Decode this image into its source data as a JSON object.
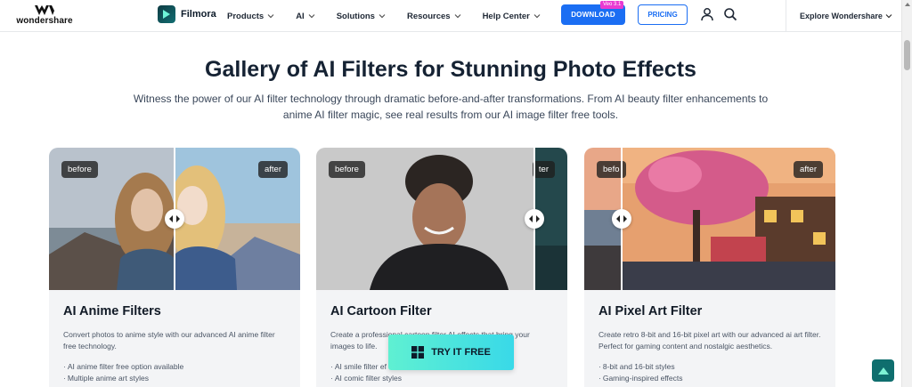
{
  "header": {
    "brand": "wondershare",
    "product": "Filmora",
    "nav": [
      "Products",
      "AI",
      "Solutions",
      "Resources",
      "Help Center"
    ],
    "download_label": "DOWNLOAD",
    "download_badge": "Veo 3.1",
    "pricing_label": "PRICING",
    "explore_label": "Explore Wondershare"
  },
  "hero": {
    "title": "Gallery of AI Filters for Stunning Photo Effects",
    "subtitle": "Witness the power of our AI filter technology through dramatic before-and-after transformations. From AI beauty filter enhancements to anime AI filter magic, see real results from our AI image filter free tools."
  },
  "cards": [
    {
      "before": "before",
      "after": "after",
      "title": "AI Anime Filters",
      "desc": "Convert photos to anime style with our advanced AI anime filter free technology.",
      "features": [
        "AI anime filter free option available",
        "Multiple anime art styles"
      ]
    },
    {
      "before": "before",
      "after": "ter",
      "title": "AI Cartoon Filter",
      "desc": "Create a professional cartoon filter AI effects that bring your images to life.",
      "features": [
        "AI smile filter ef",
        "AI comic filter styles"
      ]
    },
    {
      "before": "befo",
      "after": "after",
      "title": "AI Pixel Art Filter",
      "desc": "Create retro 8-bit and 16-bit pixel art with our advanced ai art filter. Perfect for gaming content and nostalgic aesthetics.",
      "features": [
        "8-bit and 16-bit styles",
        "Gaming-inspired effects"
      ]
    }
  ],
  "cta": {
    "label": "TRY IT FREE"
  },
  "colors": {
    "primary": "#1b6ef3",
    "cta_start": "#5ff0d2",
    "cta_end": "#39d9e8",
    "backtop": "#0f6e6e"
  }
}
